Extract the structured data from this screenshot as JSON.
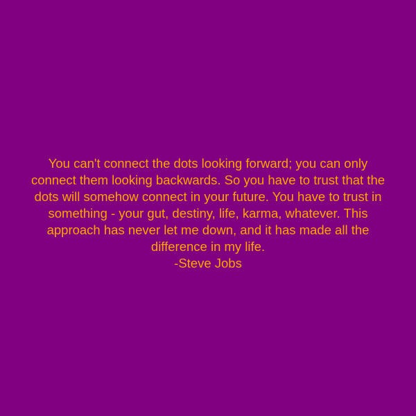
{
  "colors": {
    "background": "#800080",
    "text": "#ffa500"
  },
  "quote": {
    "lines": [
      "You can't connect the dots looking forward; you can only",
      "connect them looking backwards. So you have to trust that the",
      "dots will somehow connect in your future. You have to trust in",
      "something - your gut, destiny, life, karma, whatever. This",
      "approach has never let me down, and it has made all the",
      "difference in my life."
    ],
    "author": "-Steve Jobs"
  }
}
